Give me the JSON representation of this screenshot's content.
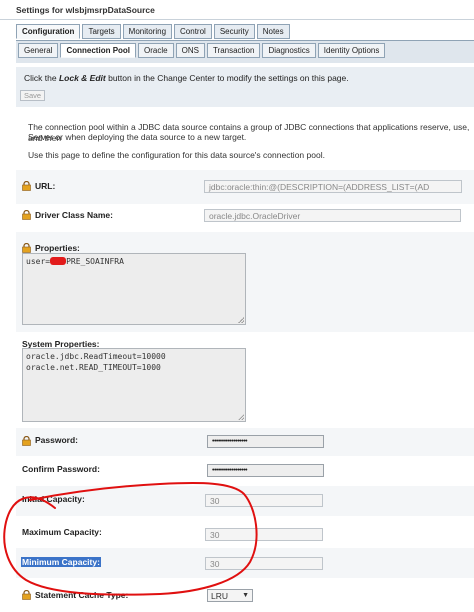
{
  "window": {
    "title": "Settings for wlsbjmsrpDataSource"
  },
  "tabs_primary": [
    {
      "label": "Configuration",
      "active": true
    },
    {
      "label": "Targets",
      "active": false
    },
    {
      "label": "Monitoring",
      "active": false
    },
    {
      "label": "Control",
      "active": false
    },
    {
      "label": "Security",
      "active": false
    },
    {
      "label": "Notes",
      "active": false
    }
  ],
  "tabs_secondary": [
    {
      "label": "General",
      "active": false
    },
    {
      "label": "Connection Pool",
      "active": true
    },
    {
      "label": "Oracle",
      "active": false
    },
    {
      "label": "ONS",
      "active": false
    },
    {
      "label": "Transaction",
      "active": false
    },
    {
      "label": "Diagnostics",
      "active": false
    },
    {
      "label": "Identity Options",
      "active": false
    }
  ],
  "change_center": {
    "prefix": "Click the ",
    "emphasis": "Lock & Edit",
    "suffix": " button in the Change Center to modify the settings on this page.",
    "save_label": "Save"
  },
  "description": {
    "line1": "The connection pool within a JDBC data source contains a group of JDBC connections that applications reserve, use, and then",
    "line2": "Server or when deploying the data source to a new target.",
    "line3": "Use this page to define the configuration for this data source's connection pool."
  },
  "fields": {
    "url": {
      "label": "URL:",
      "value": "jdbc:oracle:thin:@(DESCRIPTION=(ADDRESS_LIST=(AD"
    },
    "driver": {
      "label": "Driver Class Name:",
      "value": "oracle.jdbc.OracleDriver"
    },
    "properties": {
      "label": "Properties:",
      "value_prefix": "user=",
      "value_suffix": "PRE_SOAINFRA"
    },
    "system_properties": {
      "label": "System Properties:",
      "line1": "oracle.jdbc.ReadTimeout=10000",
      "line2": "oracle.net.READ_TIMEOUT=1000"
    },
    "password": {
      "label": "Password:",
      "value": "••••••••••••••••••"
    },
    "confirm_password": {
      "label": "Confirm Password:",
      "value": "••••••••••••••••••"
    },
    "initial_capacity": {
      "label": "Initial Capacity:",
      "value": "30"
    },
    "maximum_capacity": {
      "label": "Maximum Capacity:",
      "value": "30"
    },
    "minimum_capacity": {
      "label": "Minimum Capacity:",
      "value": "30"
    },
    "statement_cache_type": {
      "label": "Statement Cache Type:",
      "value": "LRU"
    }
  },
  "colors": {
    "annotation_red": "#e01010",
    "selection_blue": "#3b73c8"
  }
}
